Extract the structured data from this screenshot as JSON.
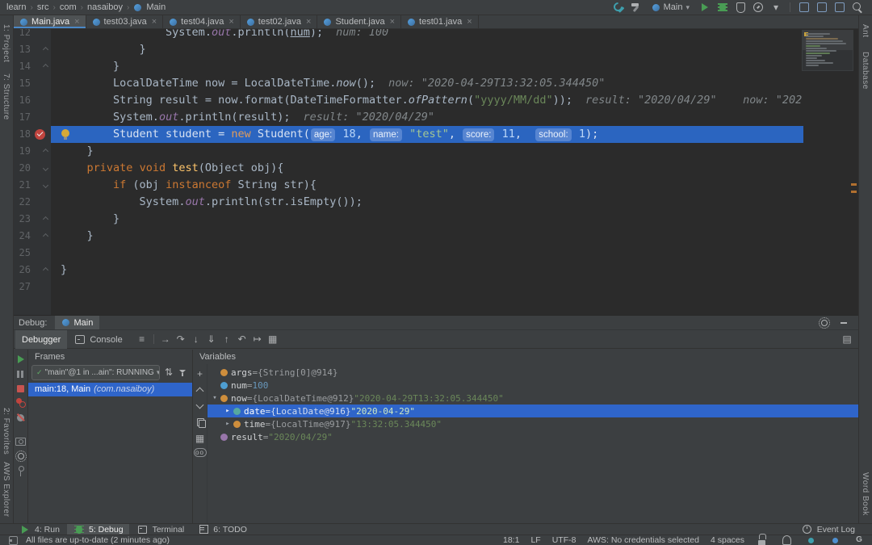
{
  "topbar": {
    "breadcrumbs": [
      "learn",
      "src",
      "com",
      "nasaiboy",
      "Main"
    ],
    "separator": "›",
    "icons_left": [
      {
        "n": "wrench-icon"
      },
      {
        "n": "build-hammer-icon"
      }
    ],
    "run_config": {
      "label": "Main",
      "arrow": "▾"
    },
    "icons_right": [
      {
        "n": "run-play-icon"
      },
      {
        "n": "debug-bug-icon"
      },
      {
        "n": "coverage-icon"
      },
      {
        "n": "profiler-icon"
      },
      {
        "n": "chevron-down-small-icon",
        "glyph": "▾"
      },
      {
        "n": "sep"
      },
      {
        "n": "ide-tool-icon"
      },
      {
        "n": "ide-tool-icon"
      },
      {
        "n": "ide-tool-icon"
      },
      {
        "n": "search-icon"
      }
    ]
  },
  "close_glyph": "×",
  "tabs": [
    {
      "label": "Main.java",
      "selected": true
    },
    {
      "label": "test03.java"
    },
    {
      "label": "test04.java"
    },
    {
      "label": "test02.java"
    },
    {
      "label": "Student.java"
    },
    {
      "label": "test01.java"
    }
  ],
  "left_stripe": [
    "1: Project",
    "7: Structure",
    "2: Favorites",
    "AWS Explorer"
  ],
  "right_stripe": [
    "Ant",
    "Database",
    "Word Book"
  ],
  "editor": {
    "lines": [
      {
        "num": "12",
        "indent": 16,
        "tok": [
          [
            "d",
            "System."
          ],
          [
            "sf",
            "out"
          ],
          [
            "d",
            ".println("
          ],
          [
            "u",
            "num"
          ],
          [
            "d",
            ");"
          ]
        ],
        "hint": "num: 100"
      },
      {
        "num": "13",
        "indent": 12,
        "fold": "up",
        "tok": [
          [
            "d",
            "}"
          ]
        ]
      },
      {
        "num": "14",
        "indent": 8,
        "fold": "up",
        "tok": [
          [
            "d",
            "}"
          ]
        ]
      },
      {
        "num": "15",
        "indent": 8,
        "tok": [
          [
            "d",
            "LocalDateTime now = LocalDateTime."
          ],
          [
            "si",
            "now"
          ],
          [
            "d",
            "();"
          ]
        ],
        "hint": "now: \"2020-04-29T13:32:05.344450\""
      },
      {
        "num": "16",
        "indent": 8,
        "tok": [
          [
            "d",
            "String result = now.format(DateTimeFormatter."
          ],
          [
            "si",
            "ofPattern"
          ],
          [
            "d",
            "("
          ],
          [
            "s",
            "\"yyyy/MM/dd\""
          ],
          [
            "d",
            "));"
          ]
        ],
        "hint": "result: \"2020/04/29\"    now: \"202"
      },
      {
        "num": "17",
        "indent": 8,
        "tok": [
          [
            "d",
            "System."
          ],
          [
            "sf",
            "out"
          ],
          [
            "d",
            ".println(result);"
          ]
        ],
        "hint": "result: \"2020/04/29\""
      },
      {
        "num": "18",
        "indent": 8,
        "exec": true,
        "breakpoint": true,
        "bulb": true,
        "tok": [
          [
            "d",
            "Student student = "
          ],
          [
            "k",
            "new"
          ],
          [
            "d",
            " Student("
          ],
          [
            "chip",
            "age:"
          ],
          [
            "d",
            " "
          ],
          [
            "n",
            "18"
          ],
          [
            "d",
            ", "
          ],
          [
            "chip",
            "name:"
          ],
          [
            "d",
            " "
          ],
          [
            "s",
            "\"test\""
          ],
          [
            "d",
            ", "
          ],
          [
            "chip",
            "score:"
          ],
          [
            "d",
            " "
          ],
          [
            "n",
            "11"
          ],
          [
            "d",
            ",  "
          ],
          [
            "chip",
            "school:"
          ],
          [
            "d",
            " "
          ],
          [
            "n",
            "1"
          ],
          [
            "d",
            ");"
          ]
        ]
      },
      {
        "num": "19",
        "indent": 4,
        "fold": "up",
        "tok": [
          [
            "d",
            "}"
          ]
        ]
      },
      {
        "num": "20",
        "indent": 4,
        "fold": "down",
        "tok": [
          [
            "k",
            "private"
          ],
          [
            "d",
            " "
          ],
          [
            "k",
            "void"
          ],
          [
            "d",
            " "
          ],
          [
            "m",
            "test"
          ],
          [
            "d",
            "(Object obj){"
          ]
        ]
      },
      {
        "num": "21",
        "indent": 8,
        "fold": "down",
        "tok": [
          [
            "k",
            "if"
          ],
          [
            "d",
            " (obj "
          ],
          [
            "k",
            "instanceof"
          ],
          [
            "d",
            " String str){"
          ]
        ]
      },
      {
        "num": "22",
        "indent": 12,
        "tok": [
          [
            "d",
            "System."
          ],
          [
            "sf",
            "out"
          ],
          [
            "d",
            ".println(str.isEmpty());"
          ]
        ]
      },
      {
        "num": "23",
        "indent": 8,
        "fold": "up",
        "tok": [
          [
            "d",
            "}"
          ]
        ]
      },
      {
        "num": "24",
        "indent": 4,
        "fold": "up",
        "tok": [
          [
            "d",
            "}"
          ]
        ]
      },
      {
        "num": "25",
        "indent": 0,
        "tok": []
      },
      {
        "num": "26",
        "indent": 0,
        "fold": "up",
        "tok": [
          [
            "d",
            "}"
          ]
        ]
      },
      {
        "num": "27",
        "indent": 0,
        "tok": []
      }
    ]
  },
  "debug": {
    "label": "Debug:",
    "tab": "Main",
    "toolbar_tabs": [
      {
        "label": "Debugger",
        "selected": true
      },
      {
        "label": "Console",
        "icon": "console-icon"
      }
    ],
    "toolbar_icons": [
      {
        "n": "menu-icon",
        "glyph": "≡"
      },
      {
        "n": "sep"
      },
      {
        "n": "show-execution-point-icon",
        "glyph": "→"
      },
      {
        "n": "step-over-icon",
        "glyph": "↷"
      },
      {
        "n": "step-into-icon",
        "glyph": "↓"
      },
      {
        "n": "force-step-into-icon",
        "glyph": "⇓"
      },
      {
        "n": "step-out-icon",
        "glyph": "↑"
      },
      {
        "n": "drop-frame-icon",
        "glyph": "↶"
      },
      {
        "n": "run-to-cursor-icon",
        "glyph": "↦"
      },
      {
        "n": "evaluate-expression-icon",
        "glyph": "▦"
      }
    ],
    "toolbar_right_icons": [
      {
        "n": "layout-settings-icon",
        "glyph": "▤"
      }
    ],
    "left_toolbar": [
      {
        "n": "resume-icon"
      },
      {
        "n": "pause-icon"
      },
      {
        "n": "stop-icon"
      },
      {
        "n": "view-breakpoints-icon"
      },
      {
        "n": "mute-breakpoints-icon"
      },
      {
        "n": "gap"
      },
      {
        "n": "thread-dump-icon"
      },
      {
        "n": "settings-gear-icon"
      },
      {
        "n": "pin-icon"
      }
    ],
    "frames": {
      "title": "Frames",
      "check": "✓",
      "thread": "\"main\"@1 in ...ain\": RUNNING",
      "arrow": "▾",
      "header_icons": [
        {
          "n": "sort-icon",
          "glyph": "⇅"
        },
        {
          "n": "filter-icon"
        }
      ],
      "rows": [
        {
          "text": "main:18, Main",
          "pkg": "(com.nasaiboy)",
          "selected": true
        }
      ]
    },
    "variables": {
      "title": "Variables",
      "glyphs": {
        "expand_open": "▾",
        "expand_closed": "▸"
      },
      "toolbar": [
        {
          "n": "add-watch-icon",
          "glyph": "+"
        },
        {
          "n": "chevron-up-icon"
        },
        {
          "n": "chevron-down-icon"
        },
        {
          "n": "copy-icon"
        },
        {
          "n": "layout-icon",
          "glyph": "▦"
        },
        {
          "n": "show-watches-icon",
          "glyph": "oo"
        }
      ],
      "rows": [
        {
          "depth": 0,
          "expand": "",
          "color": "#CE8E3C",
          "name": "args",
          "eq": " = ",
          "ref": "{String[0]@914}",
          "value": "",
          "vtype": ""
        },
        {
          "depth": 0,
          "expand": "",
          "color": "#4E9ED1",
          "name": "num",
          "eq": " = ",
          "ref": "",
          "value": "100",
          "vtype": "num"
        },
        {
          "depth": 0,
          "expand": "open",
          "color": "#CE8E3C",
          "name": "now",
          "eq": " = ",
          "ref": "{LocalDateTime@912}",
          "value": "\"2020-04-29T13:32:05.344450\"",
          "vtype": "str"
        },
        {
          "depth": 1,
          "expand": "closed",
          "color": "#56A8A0",
          "name": "date",
          "eq": " = ",
          "ref": "{LocalDate@916}",
          "value": "\"2020-04-29\"",
          "vtype": "str",
          "selected": true
        },
        {
          "depth": 1,
          "expand": "closed",
          "color": "#CE8E3C",
          "name": "time",
          "eq": " = ",
          "ref": "{LocalTime@917}",
          "value": "\"13:32:05.344450\"",
          "vtype": "str"
        },
        {
          "depth": 0,
          "expand": "",
          "color": "#9876AA",
          "name": "result",
          "eq": " = ",
          "ref": "",
          "value": "\"2020/04/29\"",
          "vtype": "str"
        }
      ]
    }
  },
  "windows_bar": {
    "left": [
      {
        "icon": "run-play-icon",
        "label": "4: Run"
      },
      {
        "icon": "debug-bug-icon",
        "label": "5: Debug",
        "selected": true
      },
      {
        "icon": "terminal-icon",
        "label": "Terminal"
      },
      {
        "icon": "todo-icon",
        "label": "6: TODO"
      }
    ],
    "right": [
      {
        "icon": "event-log-icon",
        "label": "Event Log"
      }
    ]
  },
  "status_bar": {
    "message": "All files are up-to-date (2 minutes ago)",
    "items": [
      "18:1",
      "LF",
      "UTF-8",
      "AWS: No credentials selected",
      "4 spaces"
    ],
    "icons": [
      {
        "n": "lock-icon"
      },
      {
        "n": "hector-icon"
      },
      {
        "n": "indicator-dot-teal"
      },
      {
        "n": "indicator-dot-blue"
      },
      {
        "n": "gradle-badge",
        "glyph": "G"
      }
    ]
  }
}
